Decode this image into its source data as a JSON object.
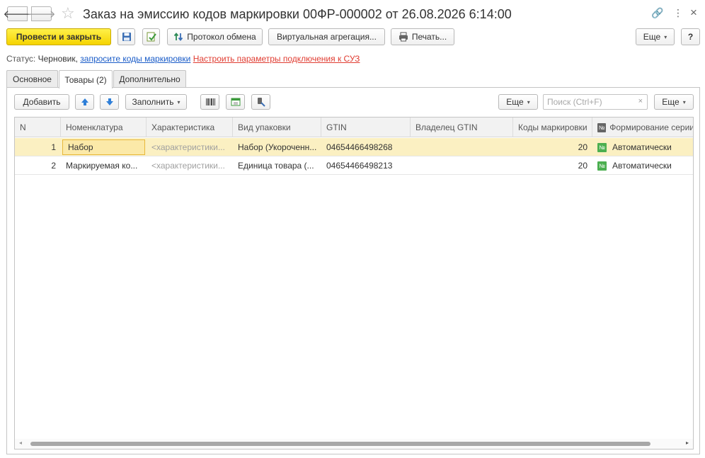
{
  "window": {
    "title": "Заказ на эмиссию кодов маркировки 00ФР-000002 от 26.08.2026 6:14:00",
    "back_glyph": "🡐",
    "forward_glyph": "🡒",
    "link_glyph": "🔗",
    "menu_glyph": "⋮",
    "close_glyph": "×"
  },
  "toolbar": {
    "post_and_close": "Провести и закрыть",
    "exchange_log": "Протокол обмена",
    "virtual_aggregation": "Виртуальная агрегация...",
    "print": "Печать...",
    "more": "Еще",
    "help": "?"
  },
  "status": {
    "label": "Статус:",
    "value": "Черновик,",
    "request_link": "запросите коды маркировки",
    "settings_link": "Настроить параметры подключения к СУЗ"
  },
  "tabs": [
    {
      "label": "Основное"
    },
    {
      "label": "Товары (2)"
    },
    {
      "label": "Дополнительно"
    }
  ],
  "panel_toolbar": {
    "add": "Добавить",
    "fill": "Заполнить",
    "more": "Еще",
    "search_placeholder": "Поиск (Ctrl+F)",
    "search_clear": "×",
    "more2": "Еще"
  },
  "table": {
    "columns": [
      "N",
      "Номенклатура",
      "Характеристика",
      "Вид упаковки",
      "GTIN",
      "Владелец GTIN",
      "Коды маркировки",
      "Формирование серии"
    ],
    "header_badge": "№",
    "row_badge": "№",
    "rows": [
      {
        "n": "1",
        "nomenclature": "Набор",
        "characteristic": "<характеристики...",
        "package": "Набор (Укороченн...",
        "gtin": "04654466498268",
        "owner": "",
        "codes": "20",
        "series": "Автоматически"
      },
      {
        "n": "2",
        "nomenclature": "Маркируемая ко...",
        "characteristic": "<характеристики...",
        "package": "Единица товара (...",
        "gtin": "04654466498213",
        "owner": "",
        "codes": "20",
        "series": "Автоматически"
      }
    ]
  },
  "colors": {
    "primary_button": "#f5d300",
    "selected_row": "#fbf0c2",
    "link_blue": "#1a5cc8",
    "link_red": "#e03c31",
    "badge_green": "#4caf50"
  }
}
